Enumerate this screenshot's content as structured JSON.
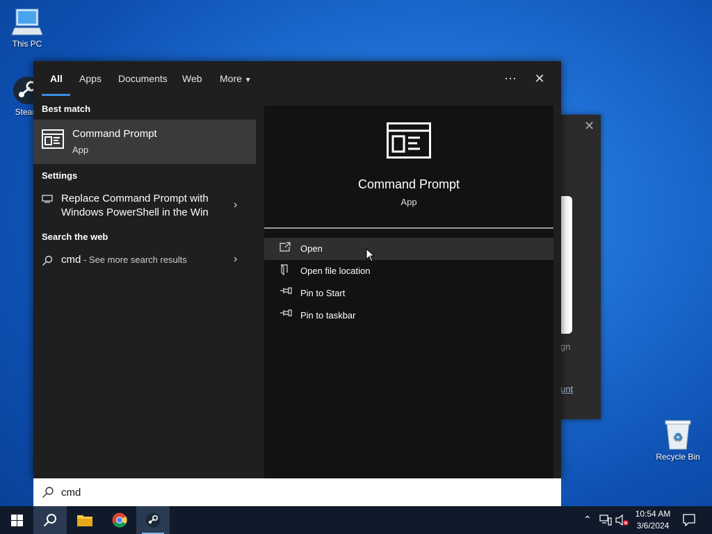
{
  "desktop": {
    "icons": [
      {
        "label": "This PC",
        "icon": "computer-icon"
      },
      {
        "label": "Steam",
        "icon": "steam-icon"
      },
      {
        "label": "Recycle Bin",
        "icon": "recycle-bin-icon"
      }
    ]
  },
  "background_dialog": {
    "text1": "gn",
    "text2": "unt"
  },
  "search_panel": {
    "tabs": [
      {
        "label": "All",
        "active": true
      },
      {
        "label": "Apps"
      },
      {
        "label": "Documents"
      },
      {
        "label": "Web"
      },
      {
        "label": "More"
      }
    ],
    "more_icon": "ellipsis-icon",
    "close_icon": "close-icon",
    "best_match": {
      "section": "Best match",
      "title": "Command Prompt",
      "subtitle": "App"
    },
    "settings": {
      "section": "Settings",
      "line1": "Replace Command Prompt with",
      "line2": "Windows PowerShell in the Win"
    },
    "web": {
      "section": "Search the web",
      "query": "cmd",
      "suffix": " - See more search results"
    },
    "preview": {
      "title": "Command Prompt",
      "subtitle": "App",
      "actions": [
        {
          "label": "Open",
          "icon": "open-icon",
          "highlighted": true
        },
        {
          "label": "Open file location",
          "icon": "file-location-icon"
        },
        {
          "label": "Pin to Start",
          "icon": "pin-icon"
        },
        {
          "label": "Pin to taskbar",
          "icon": "pin-icon"
        }
      ]
    }
  },
  "search_box": {
    "value": "cmd"
  },
  "taskbar": {
    "items": [
      "start-icon",
      "search-icon",
      "file-explorer-icon",
      "chrome-icon",
      "steam-icon"
    ],
    "clock_time": "10:54 AM",
    "clock_date": "3/6/2024"
  },
  "colors": {
    "accent": "#3a8ee6",
    "panel": "#1f1f1f",
    "preview": "#121212",
    "taskbar": "#101a2a"
  }
}
